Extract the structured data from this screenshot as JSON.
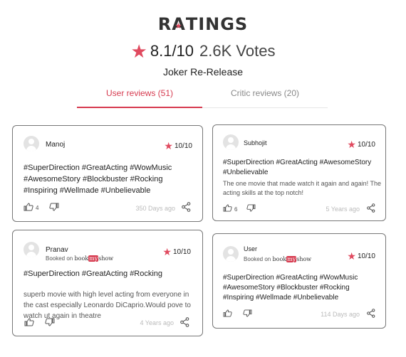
{
  "header": {
    "title_prefix": "R",
    "title_a": "A",
    "title_suffix": "TINGS",
    "score": "8.1/10",
    "votes": "2.6K Votes",
    "movie_name": "Joker Re-Release"
  },
  "tabs": {
    "user_reviews": "User reviews (51)",
    "critic_reviews": "Critic reviews (20)"
  },
  "booked_on": "Booked on",
  "bms_logo": {
    "book": "book",
    "my": "my",
    "show": "show"
  },
  "reviews": [
    {
      "user": "Manoj",
      "rating": "10/10",
      "tags": "#SuperDirection #GreatActing #WowMusic #AwesomeStory #Blockbuster #Rocking #Inspiring #Wellmade #Unbelievable",
      "text": "",
      "likes": "4",
      "time": "350 Days ago"
    },
    {
      "user": "Subhojit",
      "rating": "10/10",
      "tags": "#SuperDirection #GreatActing #AwesomeStory #Unbelievable",
      "text": "The one movie that made watch it again and again! The acting skills at the top notch!",
      "likes": "6",
      "time": "5 Years ago"
    },
    {
      "user": "Pranav",
      "booked": true,
      "rating": "10/10",
      "tags": "#SuperDirection #GreatActing #Rocking",
      "text": "superb movie with high level acting from everyone in the cast especially Leonardo DiCaprio.Would pove to watch ut again in theatre",
      "likes": "",
      "time": "4 Years ago"
    },
    {
      "user": "User",
      "booked": true,
      "rating": "10/10",
      "tags": "#SuperDirection #GreatActing #WowMusic #AwesomeStory #Blockbuster #Rocking #Inspiring #Wellmade #Unbelievable",
      "text": "",
      "likes": "",
      "time": "114 Days ago"
    }
  ],
  "colors": {
    "accent": "#d63a4f",
    "star": "#e04a5f",
    "border": "#777777"
  },
  "icons": [
    "star-icon",
    "avatar-icon",
    "thumbs-up-icon",
    "thumbs-down-icon",
    "share-icon"
  ]
}
